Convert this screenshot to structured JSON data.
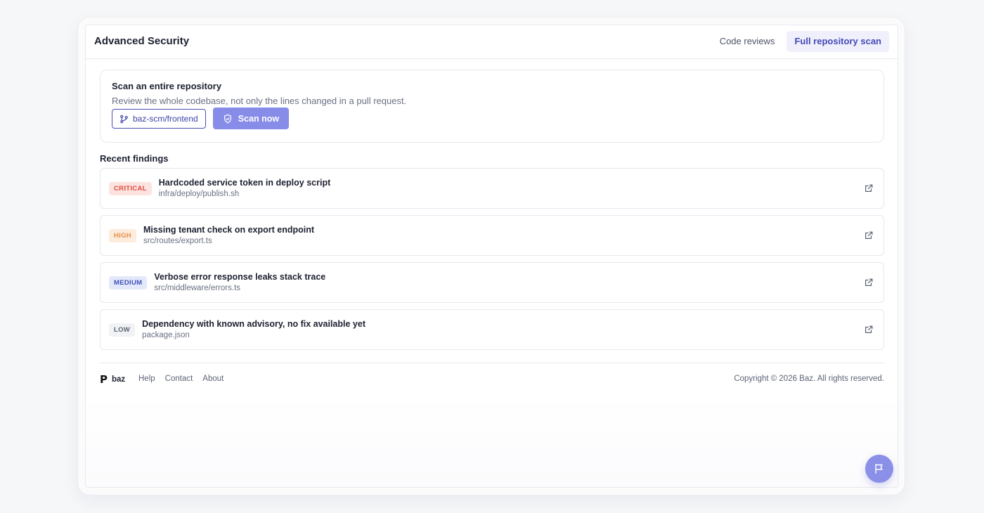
{
  "app": {
    "title": "Advanced Security"
  },
  "tabs": [
    {
      "label": "Code reviews",
      "active": false
    },
    {
      "label": "Full repository scan",
      "active": true
    }
  ],
  "scan": {
    "title": "Scan an entire repository",
    "description": "Review the whole codebase, not only the lines changed in a pull request.",
    "repo": "baz-scm/frontend",
    "repo_icon": "git-branch-icon",
    "scan_label": "Scan now",
    "scan_icon": "shield-check-icon"
  },
  "findings_title": "Recent findings",
  "findings": [
    {
      "severity": "CRITICAL",
      "title": "Hardcoded service token in deploy script",
      "path": "infra/deploy/publish.sh",
      "badge_bg": "#fde3e0",
      "badge_fg": "#dd4b3a"
    },
    {
      "severity": "HIGH",
      "title": "Missing tenant check on export endpoint",
      "path": "src/routes/export.ts",
      "badge_bg": "#fdebdc",
      "badge_fg": "#e59049"
    },
    {
      "severity": "MEDIUM",
      "title": "Verbose error response leaks stack trace",
      "path": "src/middleware/errors.ts",
      "badge_bg": "#e4e8fb",
      "badge_fg": "#3f52b8"
    },
    {
      "severity": "LOW",
      "title": "Dependency with known advisory, no fix available yet",
      "path": "package.json",
      "badge_bg": "#f1f2f5",
      "badge_fg": "#5b6275"
    }
  ],
  "footer": {
    "brand": "baz",
    "logo_mark": "P",
    "links": [
      "Help",
      "Contact",
      "About"
    ],
    "copyright": "Copyright © 2026 Baz. All rights reserved."
  },
  "colors": {
    "accent": "#878ce8",
    "accent_dark": "#4448b8"
  }
}
